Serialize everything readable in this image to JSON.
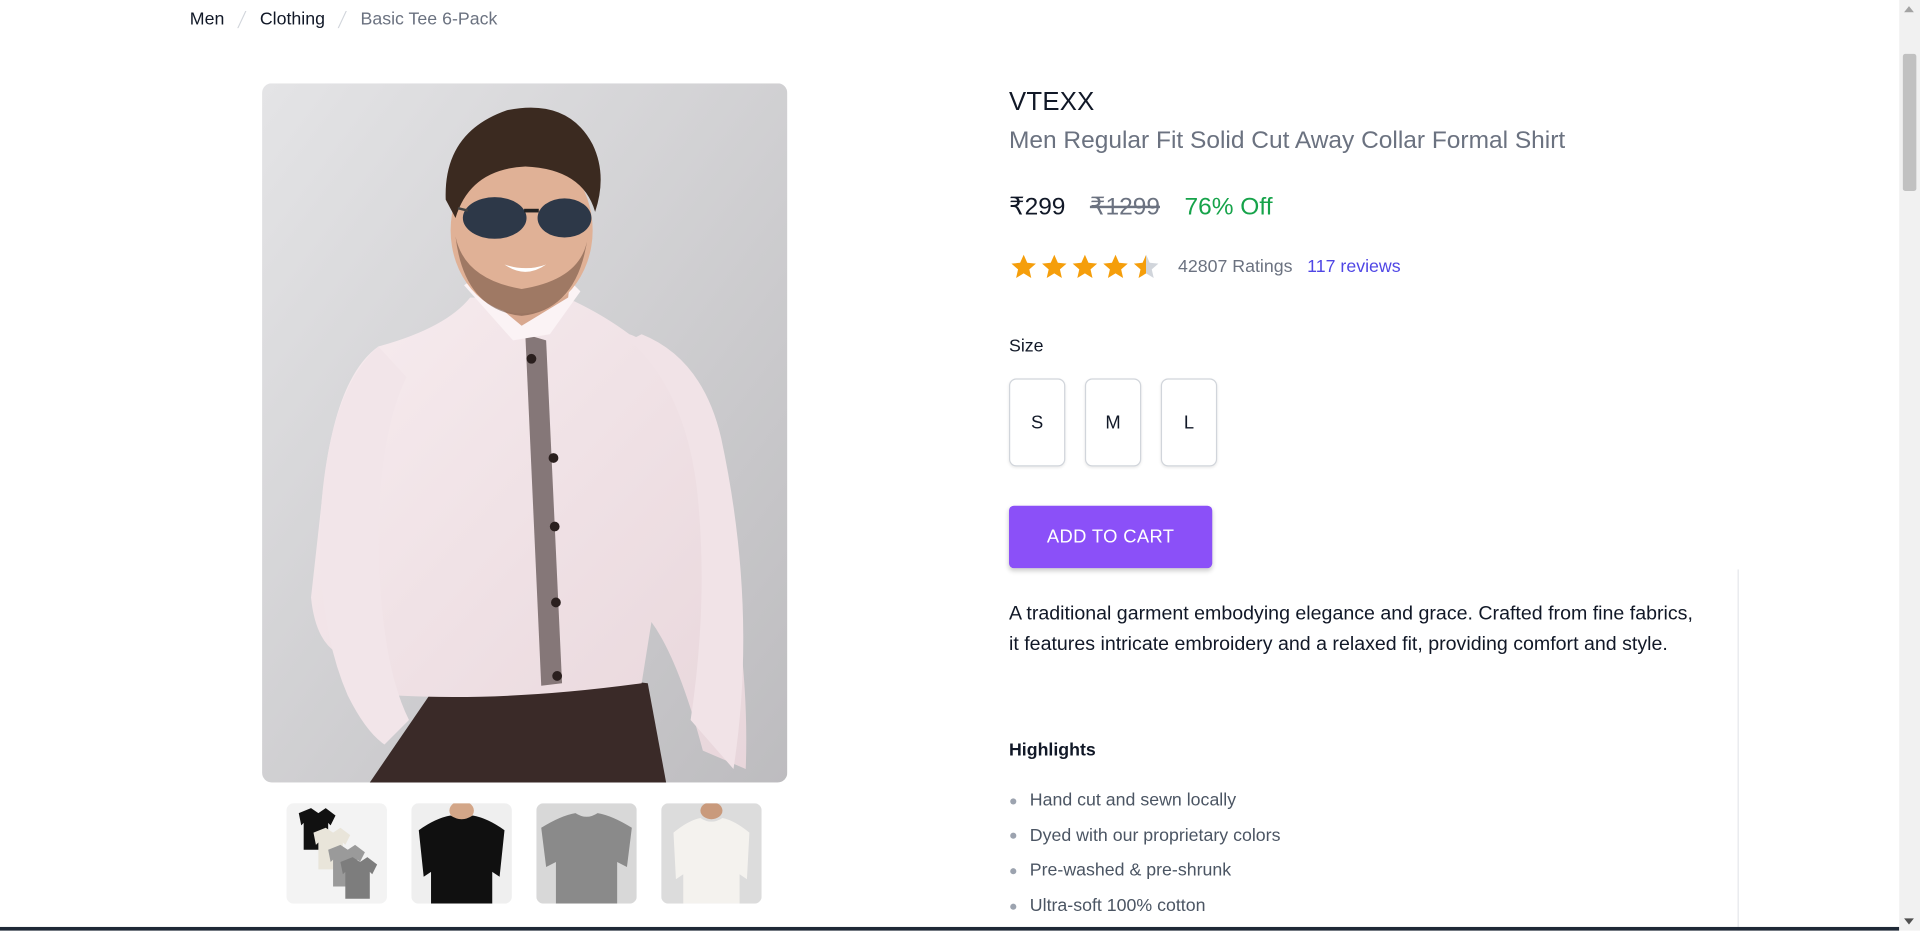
{
  "breadcrumb": [
    "Men",
    "Clothing",
    "Basic Tee 6-Pack"
  ],
  "product": {
    "brand": "VTEXX",
    "title": "Men Regular Fit Solid Cut Away Collar Formal Shirt",
    "price": "₹299",
    "mrp": "₹1299",
    "discount": "76% Off",
    "rating_value": 4.5,
    "rating_count": "42807 Ratings",
    "reviews_link": "117 reviews"
  },
  "size": {
    "label": "Size",
    "options": [
      "S",
      "M",
      "L"
    ]
  },
  "cart_button": "ADD TO CART",
  "description": "A traditional garment embodying elegance and grace. Crafted from fine fabrics, it features intricate embroidery and a relaxed fit, providing comfort and style.",
  "highlights": {
    "title": "Highlights",
    "items": [
      "Hand cut and sewn locally",
      "Dyed with our proprietary colors",
      "Pre-washed & pre-shrunk",
      "Ultra-soft 100% cotton"
    ]
  },
  "thumbnails": [
    "tee-6-pack-thumbnail",
    "black-tee-thumbnail",
    "grey-tee-thumbnail",
    "white-tee-thumbnail"
  ],
  "colors": {
    "accent": "#8b50f8",
    "discount": "#16a34a",
    "star": "#f59e0b",
    "link": "#4f46e5"
  }
}
